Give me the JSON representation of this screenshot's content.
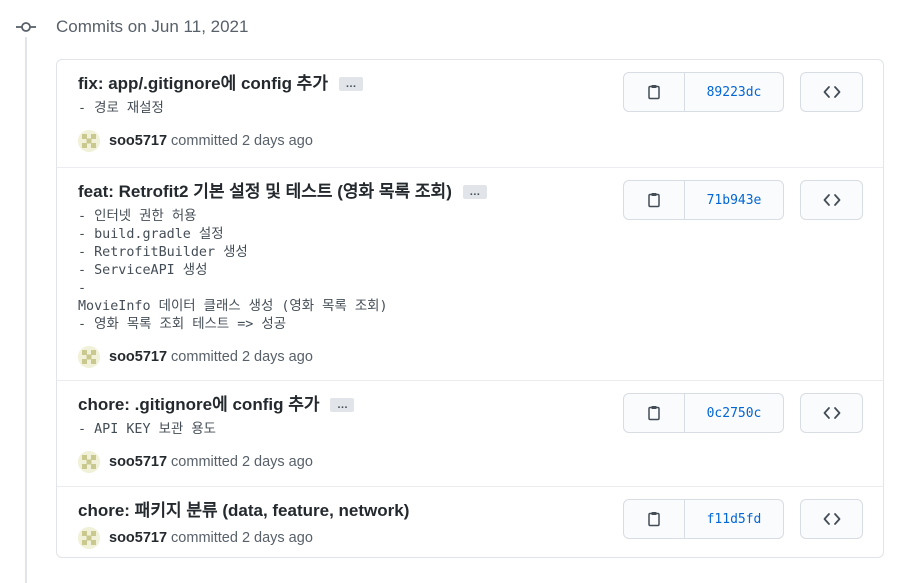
{
  "group": {
    "date_heading": "Commits on Jun 11, 2021"
  },
  "commits": [
    {
      "title": "fix: app/.gitignore에 config 추가",
      "has_description": true,
      "description": "- 경로 재설정",
      "author": "soo5717",
      "committed_label": "committed",
      "time": "2 days ago",
      "sha": "89223dc",
      "ellipsis": "…"
    },
    {
      "title": "feat: Retrofit2 기본 설정 및 테스트 (영화 목록 조회)",
      "has_description": true,
      "description": "- 인터넷 권한 허용\n- build.gradle 설정\n- RetrofitBuilder 생성\n- ServiceAPI 생성\n-\nMovieInfo 데이터 클래스 생성 (영화 목록 조회)\n- 영화 목록 조회 테스트 => 성공",
      "author": "soo5717",
      "committed_label": "committed",
      "time": "2 days ago",
      "sha": "71b943e",
      "ellipsis": "…"
    },
    {
      "title": "chore: .gitignore에 config 추가",
      "has_description": true,
      "description": "- API KEY 보관 용도",
      "author": "soo5717",
      "committed_label": "committed",
      "time": "2 days ago",
      "sha": "0c2750c",
      "ellipsis": "…"
    },
    {
      "title": "chore: 패키지 분류 (data, feature, network)",
      "has_description": false,
      "description": "",
      "author": "soo5717",
      "committed_label": "committed",
      "time": "2 days ago",
      "sha": "f11d5fd",
      "ellipsis": ""
    }
  ],
  "icons": {
    "timeline": "git-commit-icon",
    "copy": "clipboard-icon",
    "browse": "code-icon"
  },
  "colors": {
    "sha_link": "#0366d6",
    "border": "#e1e4e8",
    "muted_text": "#586069"
  }
}
